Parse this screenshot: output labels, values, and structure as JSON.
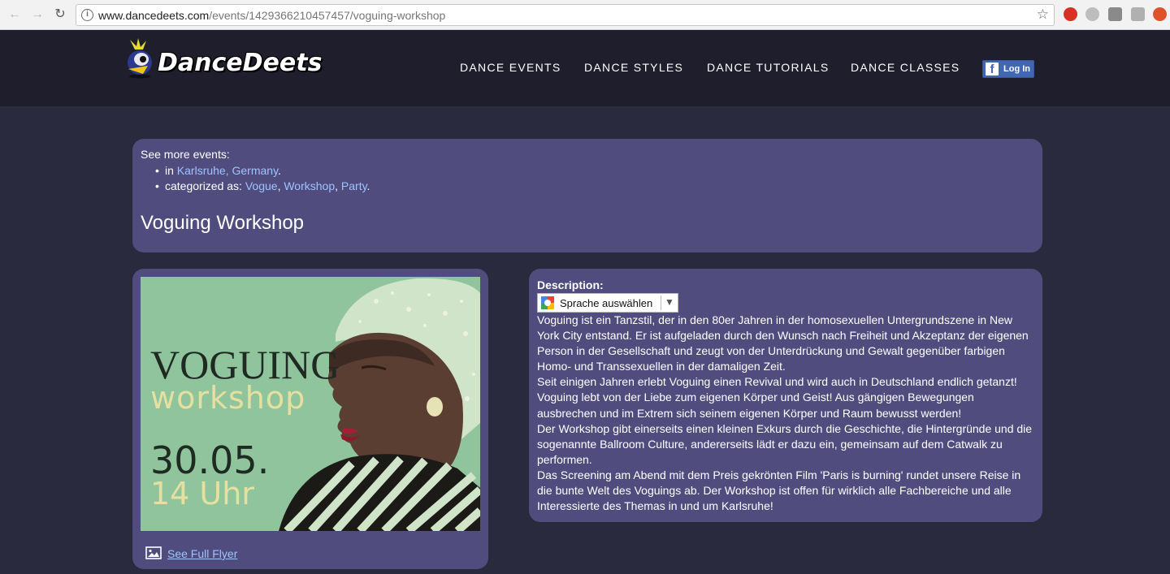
{
  "browser": {
    "url_host": "www.dancedeets.com",
    "url_path": "/events/1429366210457457/voguing-workshop"
  },
  "header": {
    "logo_text": "DanceDeets",
    "nav": [
      "DANCE EVENTS",
      "DANCE STYLES",
      "DANCE TUTORIALS",
      "DANCE CLASSES"
    ],
    "login_label": "Log In"
  },
  "colors": {
    "page_bg": "#2a2a3f",
    "header_bg": "#1e1e2d",
    "panel_bg": "#514c7e",
    "link": "#9ec3ff",
    "facebook": "#4267b2"
  },
  "see_more": {
    "title": "See more events:",
    "location_prefix": "in ",
    "location": "Karlsruhe, Germany",
    "location_suffix": ".",
    "categories_prefix": "categorized as: ",
    "categories": [
      "Vogue",
      "Workshop",
      "Party"
    ],
    "categories_suffix": "."
  },
  "event": {
    "title": "Voguing Workshop"
  },
  "flyer": {
    "line1": "VOGUING",
    "line2": "workshop",
    "date": "30.05.",
    "time": "14 Uhr",
    "link_label": "See Full Flyer"
  },
  "description": {
    "label": "Description:",
    "translate_label": "Sprache auswählen",
    "translate_arrow": "▼",
    "paragraphs": [
      "Voguing ist ein Tanzstil, der in den 80er Jahren in der homosexuellen Untergrundszene in New York City entstand. Er ist aufgeladen durch den Wunsch nach Freiheit und Akzeptanz der eigenen Person in der Gesellschaft und zeugt von der Unterdrückung und Gewalt gegenüber farbigen Homo- und Transsexuellen in der damaligen Zeit.",
      "Seit einigen Jahren erlebt Voguing einen Revival und wird auch in Deutschland endlich getanzt!",
      "Voguing lebt von der Liebe zum eigenen Körper und Geist! Aus gängigen Bewegungen ausbrechen und im Extrem sich seinem eigenen Körper und Raum bewusst werden!",
      "Der Workshop gibt einerseits einen kleinen Exkurs durch die Geschichte, die Hintergründe und die sogenannte Ballroom Culture, andererseits lädt er dazu ein, gemeinsam auf dem Catwalk zu performen.",
      "Das Screening am Abend mit dem Preis gekrönten Film 'Paris is burning' rundet unsere Reise in die bunte Welt des Voguings ab. Der Workshop ist offen für wirklich alle Fachbereiche und alle Interessierte des Themas in und um Karlsruhe!"
    ]
  }
}
